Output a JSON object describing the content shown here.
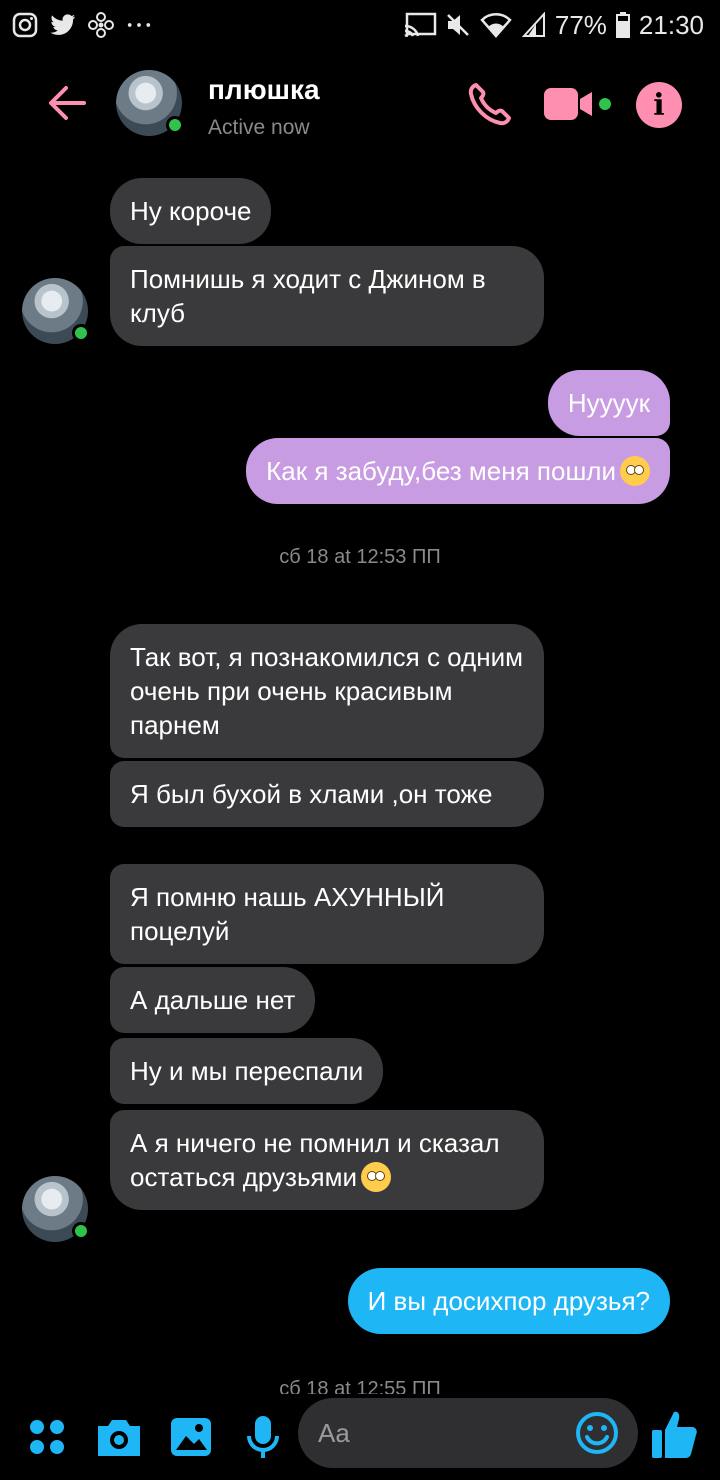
{
  "status_bar": {
    "battery": "77%",
    "time": "21:30",
    "icons": [
      "instagram-icon",
      "twitter-icon",
      "fan-icon",
      "more-dots-icon",
      "cast-icon",
      "mute-icon",
      "wifi-icon",
      "signal-icon",
      "battery-icon"
    ]
  },
  "header": {
    "name": "плюшка",
    "status": "Active now",
    "icons": [
      "back-arrow-icon",
      "phone-icon",
      "video-camera-icon",
      "info-icon"
    ],
    "accent_color": "#ff8fb0"
  },
  "messages": [
    {
      "id": "m1",
      "direction": "in",
      "text": "Ну короче"
    },
    {
      "id": "m2",
      "direction": "in",
      "text": "Помнишь я ходит с Джином в клуб"
    },
    {
      "id": "m3",
      "direction": "out",
      "text": "Нуууук"
    },
    {
      "id": "m4",
      "direction": "out",
      "text": "Как я забуду,без меня пошли",
      "emoji": "eye-roll-emoji"
    },
    {
      "id": "ts1",
      "type": "timestamp",
      "text": "сб 18 at 12:53 ПП"
    },
    {
      "id": "m5",
      "direction": "in",
      "text": "Так вот, я познакомился с одним очень при очень красивым парнем"
    },
    {
      "id": "m6",
      "direction": "in",
      "text": "Я был бухой в хлами ,он тоже"
    },
    {
      "id": "m7",
      "direction": "in",
      "text": "Я помню нашь АХУННЫЙ поцелуй"
    },
    {
      "id": "m8",
      "direction": "in",
      "text": "А дальше нет"
    },
    {
      "id": "m9",
      "direction": "in",
      "text": "Ну и мы переспали"
    },
    {
      "id": "m10",
      "direction": "in",
      "text": "А я ничего не помнил и сказал остаться друзьями",
      "emoji": "hand-over-mouth-emoji"
    },
    {
      "id": "m11",
      "direction": "out",
      "text": "И вы досихпор друзья?"
    },
    {
      "id": "ts2",
      "type": "timestamp",
      "text": "сб 18 at 12:55 ПП"
    }
  ],
  "composer": {
    "placeholder": "Aa",
    "icons": [
      "apps-icon",
      "camera-icon",
      "gallery-icon",
      "microphone-icon",
      "emoji-icon",
      "thumbs-up-icon"
    ]
  },
  "colors": {
    "incoming_bubble": "#3a3a3c",
    "outgoing_purple": "#c89ce2",
    "outgoing_blue": "#1eb6f5",
    "composer_icons": "#1eb6f5",
    "online": "#31c24d"
  }
}
